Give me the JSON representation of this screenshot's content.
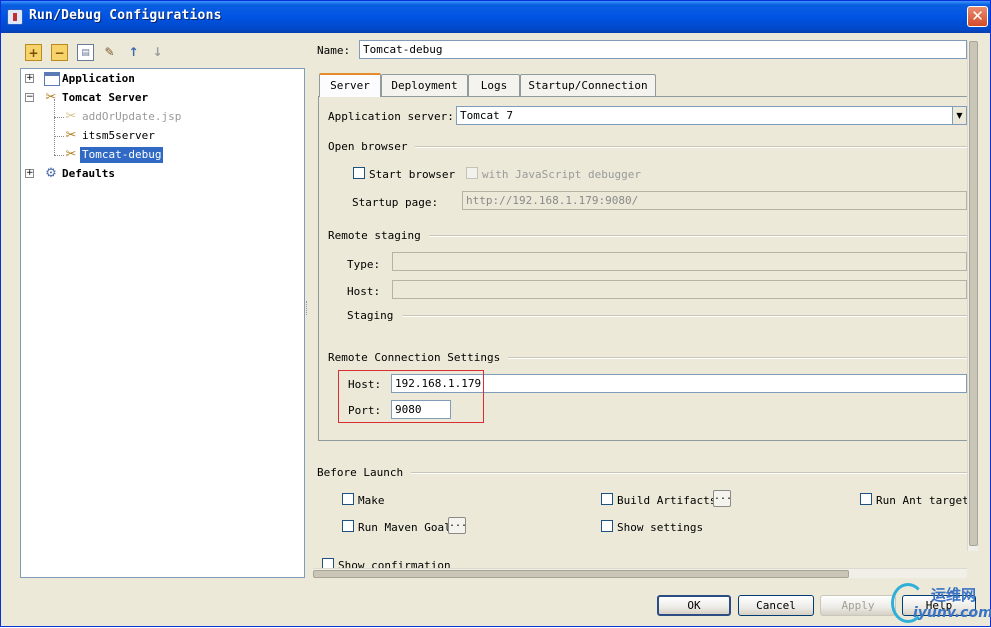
{
  "window": {
    "title": "Run/Debug Configurations",
    "close_label": "✕"
  },
  "toolbar": {
    "add": "+",
    "remove": "−",
    "copy": "▤",
    "edit": "✎",
    "up": "↑",
    "down": "↓"
  },
  "tree": {
    "application": "Application",
    "tomcat_server": "Tomcat Server",
    "tomcat_children": [
      "addOrUpdate.jsp",
      "itsm5server",
      "Tomcat-debug"
    ],
    "defaults": "Defaults",
    "expander_plus": "+",
    "expander_minus": "−"
  },
  "name": {
    "label": "Name:",
    "value": "Tomcat-debug"
  },
  "tabs": [
    "Server",
    "Deployment",
    "Logs",
    "Startup/Connection"
  ],
  "server": {
    "app_server_label": "Application server:",
    "app_server_value": "Tomcat 7",
    "open_browser_title": "Open browser",
    "start_browser_label": "Start browser",
    "js_debugger_label": "with JavaScript debugger",
    "startup_page_label": "Startup page:",
    "startup_page_value": "http://192.168.1.179:9080/",
    "remote_staging_title": "Remote staging",
    "type_label": "Type:",
    "host_label": "Host:",
    "staging_label": "Staging",
    "remote_conn_title": "Remote Connection Settings",
    "conn_host_label": "Host:",
    "conn_host_value": "192.168.1.179",
    "conn_port_label": "Port:",
    "conn_port_value": "9080"
  },
  "before_launch": {
    "title": "Before Launch",
    "make": "Make",
    "build_artifacts": "Build Artifacts",
    "run_ant_target": "Run Ant target",
    "run_maven_goal": "Run Maven Goal",
    "show_settings": "Show settings",
    "show_confirmation": "Show confirmation",
    "ellipsis": "..."
  },
  "buttons": {
    "ok": "OK",
    "cancel": "Cancel",
    "apply": "Apply",
    "help": "Help"
  },
  "watermark": {
    "cn": "运维网",
    "en": "iyunv.com"
  },
  "colors": {
    "selection": "#316ac5",
    "highlight_box": "#d83030",
    "titlebar": "#0054e3"
  }
}
